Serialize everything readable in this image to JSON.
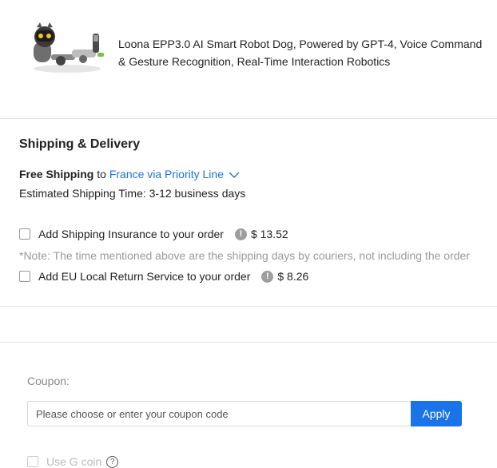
{
  "product": {
    "title": "Loona EPP3.0 AI Smart Robot Dog, Powered by GPT-4, Voice Command & Gesture Recognition, Real-Time Interaction Robotics",
    "image_icon": "robot-dog-product-image"
  },
  "shipping": {
    "section_title": "Shipping & Delivery",
    "free_shipping": "Free Shipping",
    "to_text": " to ",
    "destination": "France via Priority Line",
    "estimate": "Estimated Shipping Time: 3-12 business days",
    "note": "*Note: The time mentioned above are the shipping days by couriers, not including the order"
  },
  "options": [
    {
      "label": "Add Shipping Insurance to your order",
      "price": "$ 13.52",
      "checked": false
    },
    {
      "label": "Add EU Local Return Service to your order",
      "price": "$ 8.26",
      "checked": false
    }
  ],
  "coupon": {
    "label": "Coupon:",
    "placeholder": "Please choose or enter your coupon code",
    "value": "",
    "apply_label": "Apply"
  },
  "coins": {
    "label": "Use G coin",
    "checked": false
  },
  "colors": {
    "accent": "#1a73e8",
    "info_icon": "#9e9e9e",
    "divider": "#e3e3e3"
  }
}
